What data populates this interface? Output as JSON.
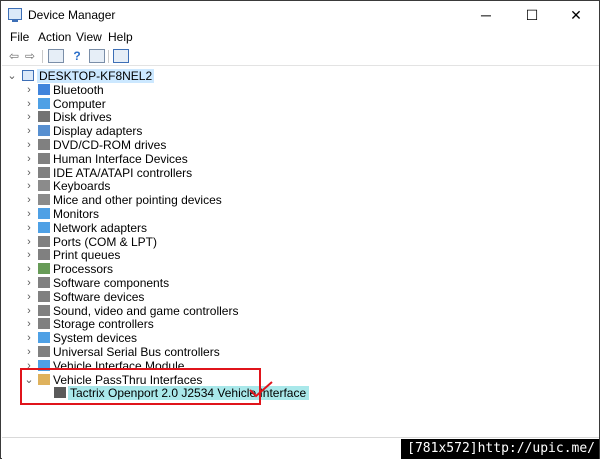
{
  "window": {
    "title": "Device Manager",
    "min": "─",
    "max": "☐",
    "close": "✕"
  },
  "menu": [
    "File",
    "Action",
    "View",
    "Help"
  ],
  "toolbar": [
    "back",
    "forward",
    "properties",
    "help",
    "update",
    "scan"
  ],
  "tree": {
    "root": "DESKTOP-KF8NEL2",
    "categories": [
      {
        "label": "Bluetooth",
        "icon": "bluetooth-icon",
        "color": "#1e6fd6"
      },
      {
        "label": "Computer",
        "icon": "computer-icon",
        "color": "#2f8fe0"
      },
      {
        "label": "Disk drives",
        "icon": "disk-drive-icon",
        "color": "#5a5a5a"
      },
      {
        "label": "Display adapters",
        "icon": "display-adapter-icon",
        "color": "#3a7bc8"
      },
      {
        "label": "DVD/CD-ROM drives",
        "icon": "dvd-drive-icon",
        "color": "#6a6a6a"
      },
      {
        "label": "Human Interface Devices",
        "icon": "hid-icon",
        "color": "#6a6a6a"
      },
      {
        "label": "IDE ATA/ATAPI controllers",
        "icon": "ide-controller-icon",
        "color": "#6a6a6a"
      },
      {
        "label": "Keyboards",
        "icon": "keyboard-icon",
        "color": "#777777"
      },
      {
        "label": "Mice and other pointing devices",
        "icon": "mouse-icon",
        "color": "#777777"
      },
      {
        "label": "Monitors",
        "icon": "monitor-icon",
        "color": "#2f8fe0"
      },
      {
        "label": "Network adapters",
        "icon": "network-adapter-icon",
        "color": "#2f8fe0"
      },
      {
        "label": "Ports (COM & LPT)",
        "icon": "port-icon",
        "color": "#6a6a6a"
      },
      {
        "label": "Print queues",
        "icon": "printer-icon",
        "color": "#6a6a6a"
      },
      {
        "label": "Processors",
        "icon": "processor-icon",
        "color": "#4c8a3a"
      },
      {
        "label": "Software components",
        "icon": "software-component-icon",
        "color": "#6a6a6a"
      },
      {
        "label": "Software devices",
        "icon": "software-device-icon",
        "color": "#6a6a6a"
      },
      {
        "label": "Sound, video and game controllers",
        "icon": "sound-icon",
        "color": "#6a6a6a"
      },
      {
        "label": "Storage controllers",
        "icon": "storage-controller-icon",
        "color": "#6a6a6a"
      },
      {
        "label": "System devices",
        "icon": "system-device-icon",
        "color": "#2f8fe0"
      },
      {
        "label": "Universal Serial Bus controllers",
        "icon": "usb-icon",
        "color": "#6a6a6a"
      },
      {
        "label": "Vehicle Interface Module",
        "icon": "vehicle-interface-icon",
        "color": "#2f8fe0"
      },
      {
        "label": "Vehicle PassThru Interfaces",
        "icon": "passthru-icon",
        "color": "#d9a441",
        "expanded": true
      }
    ],
    "child": "Tactrix Openport 2.0 J2534 Vehicle Interface"
  },
  "statusbar": {
    "watermark": "[781x572]http://upic.me/"
  },
  "colors": {
    "annotation": "#e0141b",
    "selected": "#a9e8ea"
  }
}
